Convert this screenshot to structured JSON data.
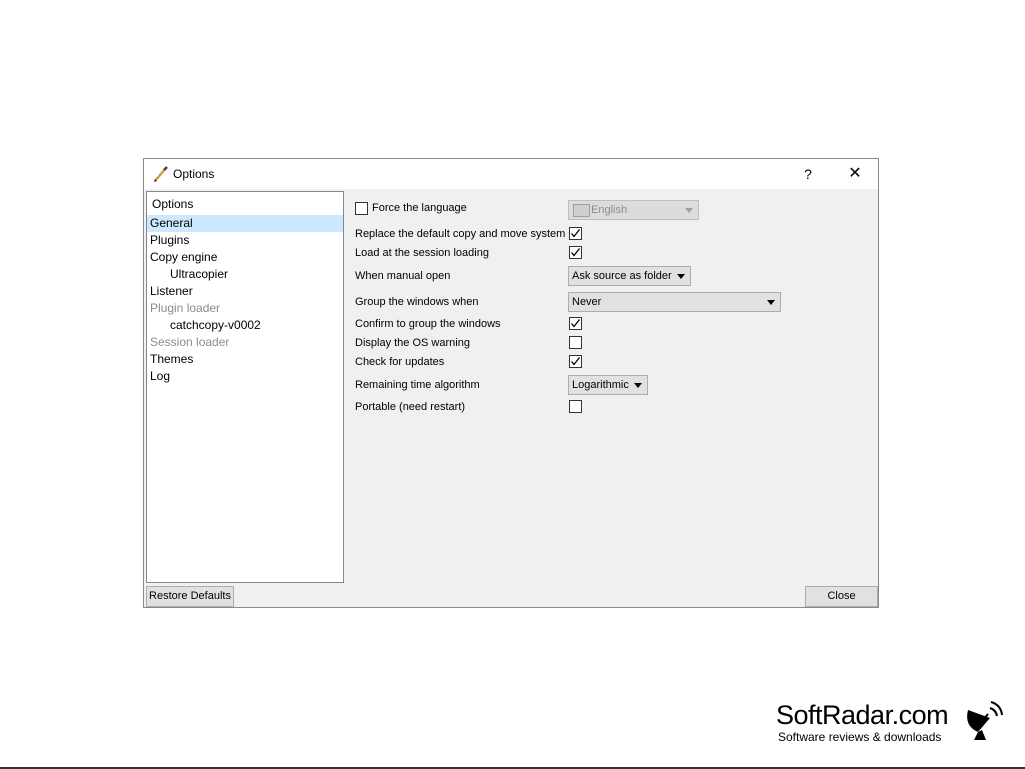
{
  "window": {
    "title": "Options",
    "help_label": "?",
    "close_glyph": "✕"
  },
  "tree": {
    "header": "Options",
    "items": [
      {
        "label": "General",
        "selected": true
      },
      {
        "label": "Plugins"
      },
      {
        "label": "Copy engine"
      },
      {
        "label": "Ultracopier"
      },
      {
        "label": "Listener"
      },
      {
        "label": "Plugin loader"
      },
      {
        "label": "catchcopy-v0002"
      },
      {
        "label": "Session loader"
      },
      {
        "label": "Themes"
      },
      {
        "label": "Log"
      }
    ]
  },
  "settings": {
    "force_language": {
      "label": "Force the language",
      "checked": false
    },
    "language_combo": {
      "value": "English"
    },
    "replace_copy": {
      "label": "Replace the default copy and move system",
      "checked": true
    },
    "load_session": {
      "label": "Load at the session loading",
      "checked": true
    },
    "manual_open": {
      "label": "When manual open",
      "value": "Ask source as folder"
    },
    "group_windows": {
      "label": "Group the windows when",
      "value": "Never"
    },
    "confirm_group": {
      "label": "Confirm to group the windows",
      "checked": true
    },
    "os_warning": {
      "label": "Display the OS warning",
      "checked": false
    },
    "check_updates": {
      "label": "Check for updates",
      "checked": true
    },
    "remaining_time": {
      "label": "Remaining time algorithm",
      "value": "Logarithmic"
    },
    "portable": {
      "label": "Portable (need restart)",
      "checked": false
    }
  },
  "buttons": {
    "restore_defaults": "Restore Defaults",
    "close": "Close"
  },
  "brand": {
    "name": "SoftRadar.com",
    "tagline": "Software reviews & downloads"
  },
  "icons": {
    "app": "pencil-icon",
    "flag": "flag-icon",
    "radar": "satellite-dish-icon"
  }
}
